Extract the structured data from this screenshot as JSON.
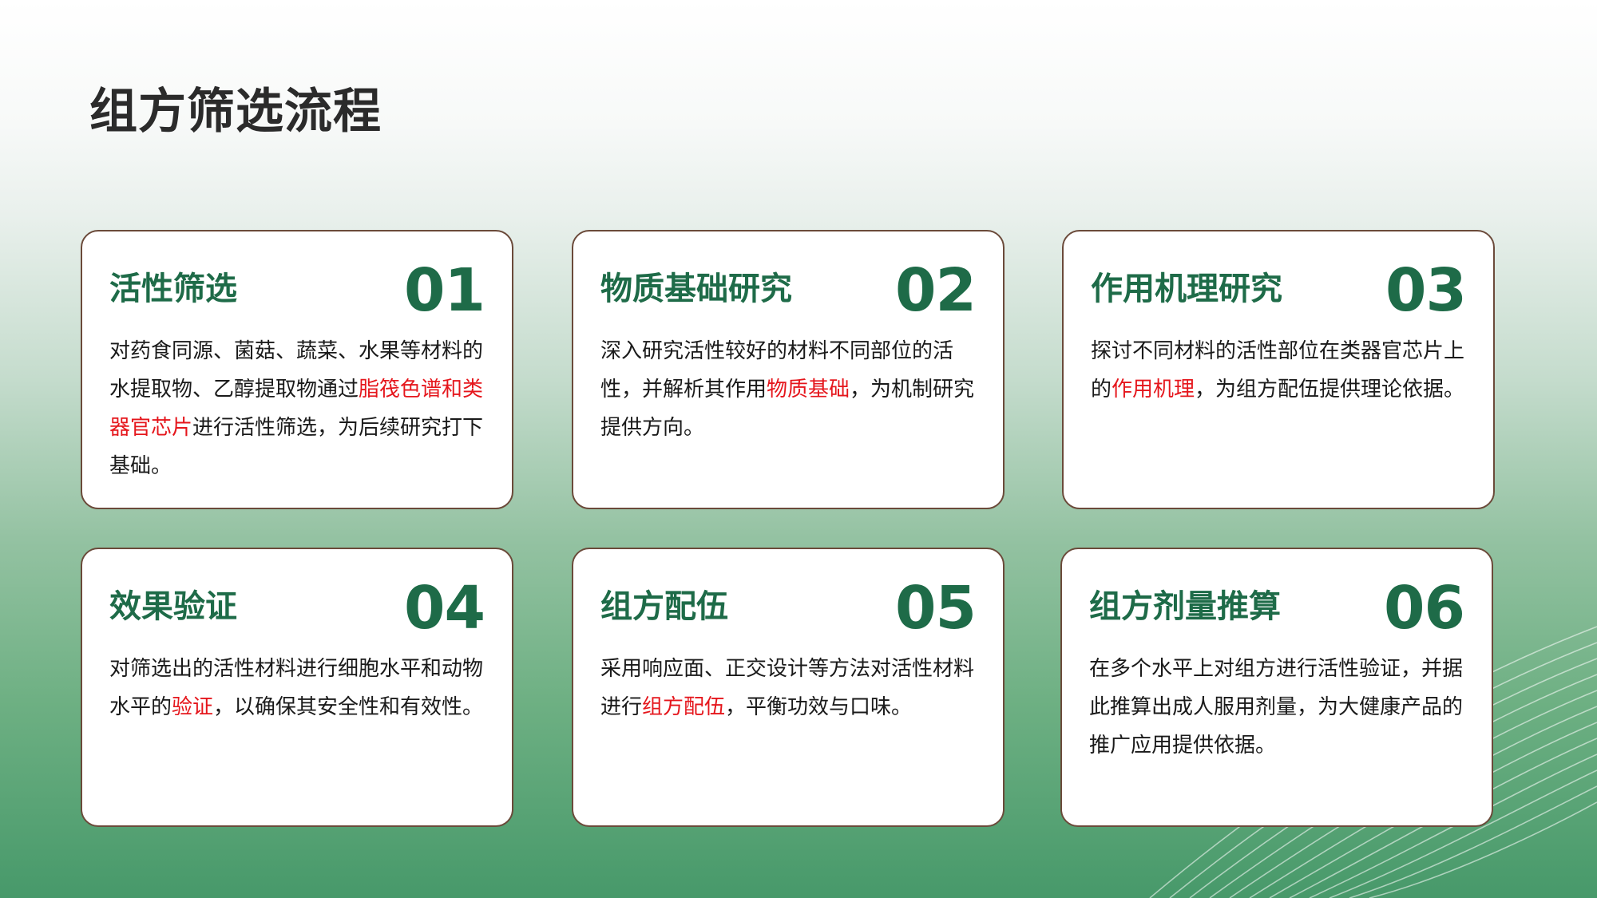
{
  "page": {
    "title": "组方筛选流程"
  },
  "colors": {
    "accent_green": "#1e6b48",
    "highlight_red": "#e5161c",
    "card_border": "#6b4a3a",
    "text": "#1a1a1a"
  },
  "cards": [
    {
      "title": "活性筛选",
      "number": "01",
      "body": {
        "before": "对药食同源、菌菇、蔬菜、水果等材料的水提取物、乙醇提取物通过",
        "highlight": "脂筏色谱和类器官芯片",
        "after": "进行活性筛选，为后续研究打下基础。"
      }
    },
    {
      "title": "物质基础研究",
      "number": "02",
      "body": {
        "before": "深入研究活性较好的材料不同部位的活性，并解析其作用",
        "highlight": "物质基础",
        "after": "，为机制研究提供方向。"
      }
    },
    {
      "title": "作用机理研究",
      "number": "03",
      "body": {
        "before": "探讨不同材料的活性部位在类器官芯片上的",
        "highlight": "作用机理",
        "after": "，为组方配伍提供理论依据。"
      }
    },
    {
      "title": "效果验证",
      "number": "04",
      "body": {
        "before": "对筛选出的活性材料进行细胞水平和动物水平的",
        "highlight": "验证",
        "after": "，以确保其安全性和有效性。"
      }
    },
    {
      "title": "组方配伍",
      "number": "05",
      "body": {
        "before": "采用响应面、正交设计等方法对活性材料进行",
        "highlight": "组方配伍",
        "after": "，平衡功效与口味。"
      }
    },
    {
      "title": "组方剂量推算",
      "number": "06",
      "body": {
        "before": "在多个水平上对组方进行活性验证，并据此推算出成人服用剂量，为大健康产品的推广应用提供依据。",
        "highlight": "",
        "after": ""
      }
    }
  ]
}
